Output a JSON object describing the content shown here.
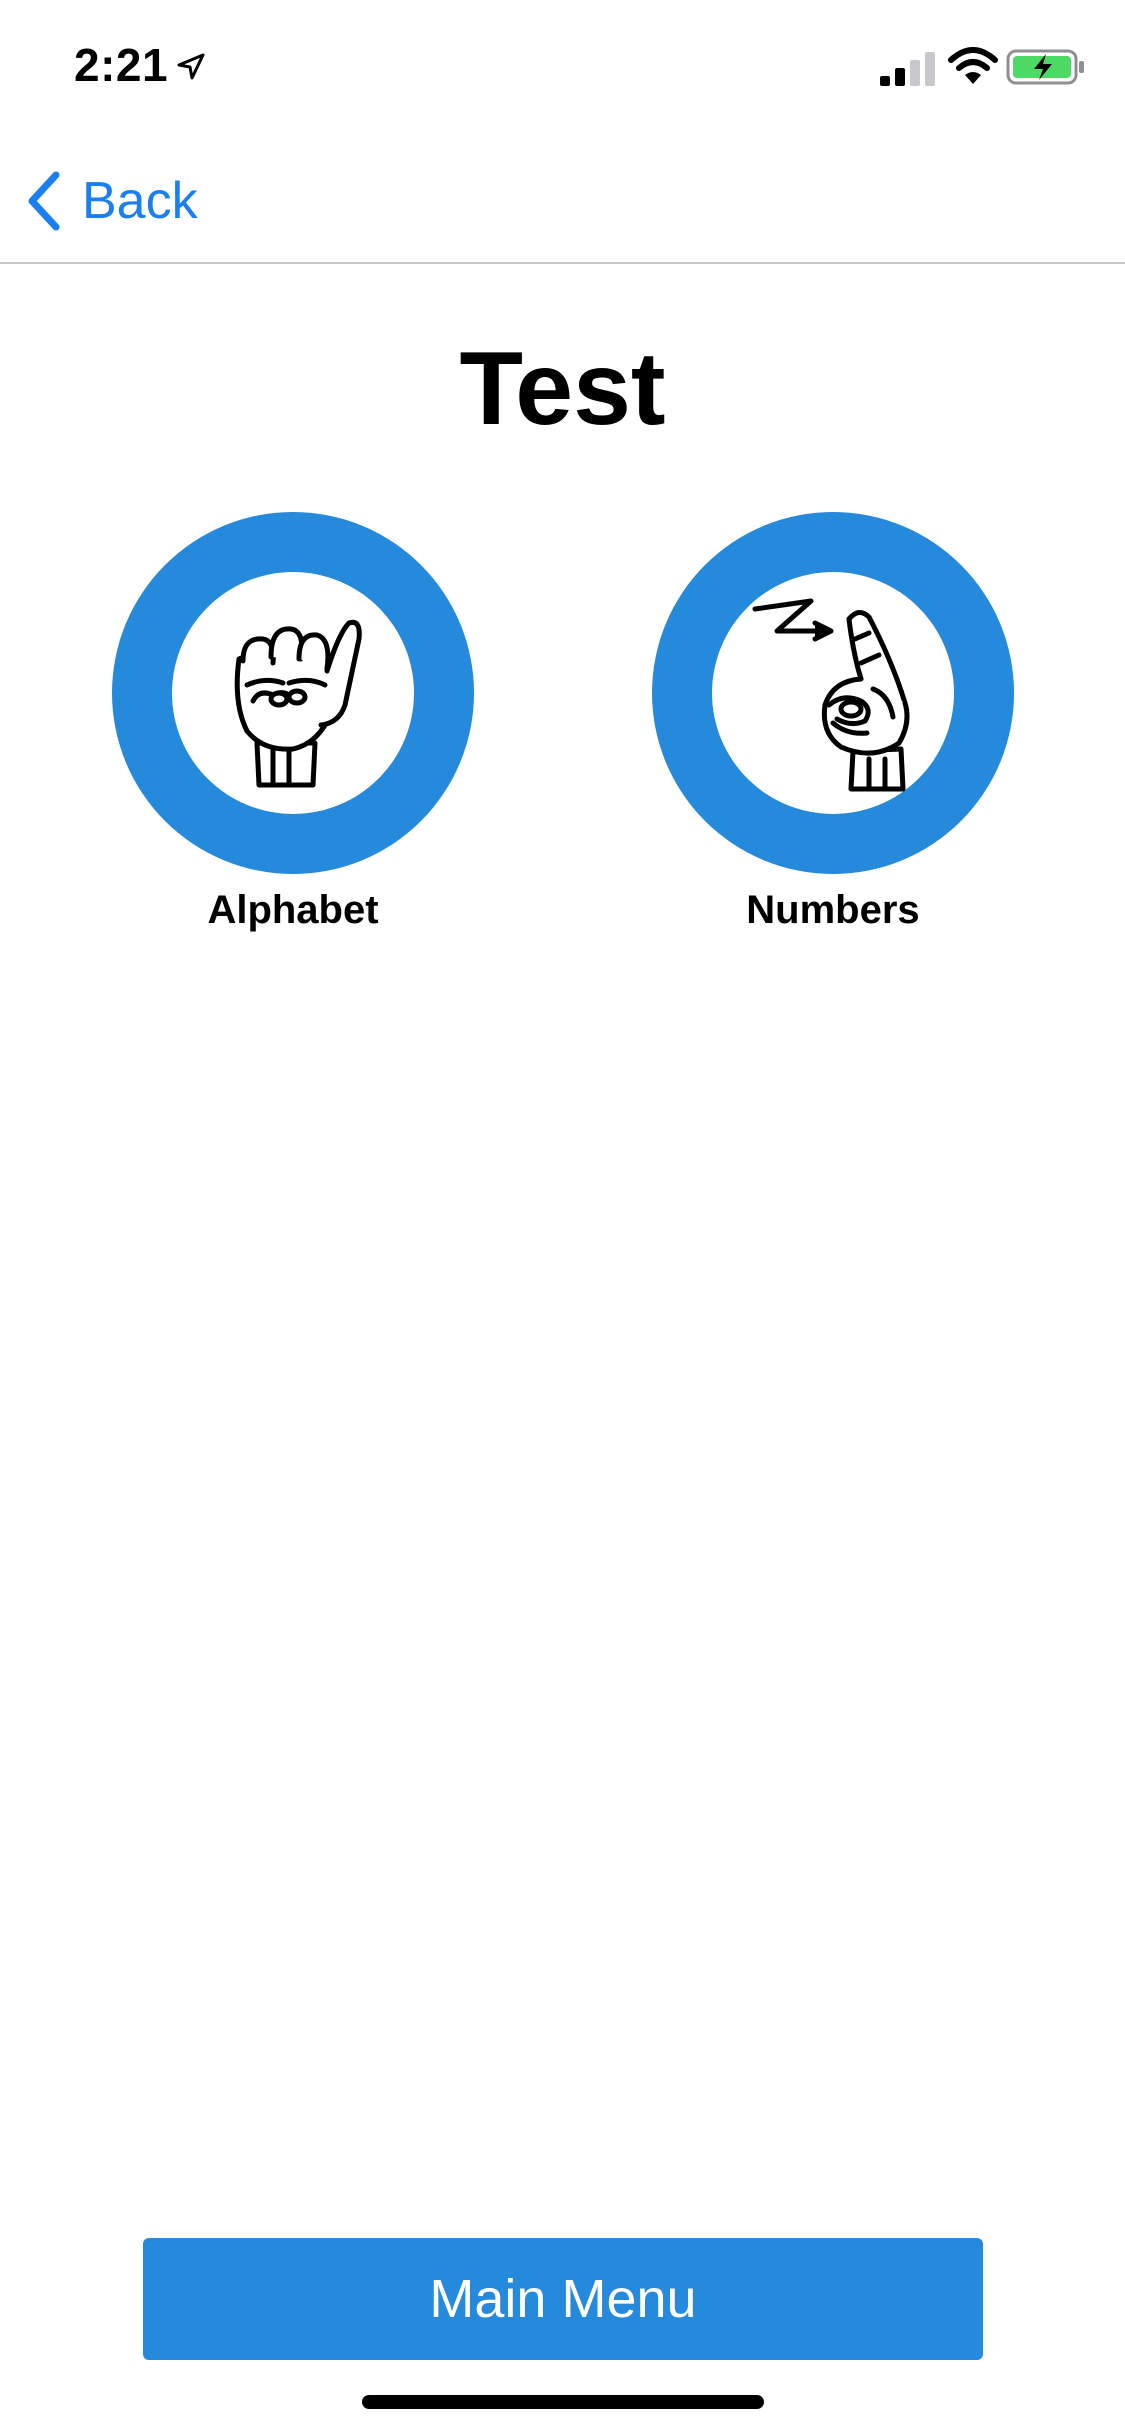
{
  "status_bar": {
    "time": "2:21",
    "icons": [
      "location-arrow-icon",
      "cellular-signal-icon",
      "wifi-icon",
      "battery-charging-icon"
    ]
  },
  "nav": {
    "back_label": "Back"
  },
  "page": {
    "title": "Test"
  },
  "categories": [
    {
      "label": "Alphabet",
      "icon": "fist-hand-sign-icon"
    },
    {
      "label": "Numbers",
      "icon": "pointing-hand-sign-icon"
    }
  ],
  "footer": {
    "main_menu_label": "Main Menu"
  },
  "colors": {
    "accent": "#2589dc",
    "link": "#1a7ff0",
    "battery_fill": "#4cd964",
    "divider": "#c9c9cc"
  }
}
